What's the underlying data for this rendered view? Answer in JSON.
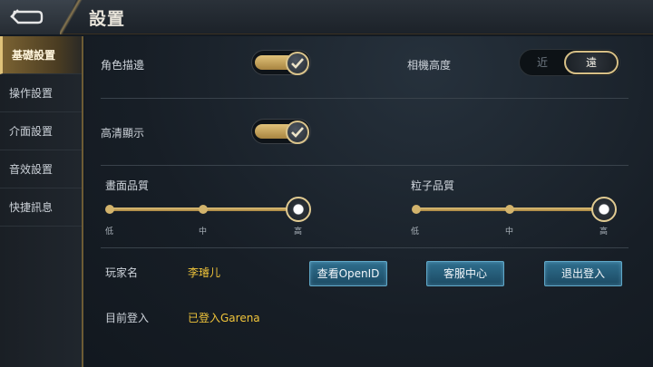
{
  "header": {
    "title": "設置"
  },
  "sidebar": {
    "items": [
      {
        "label": "基礎設置",
        "active": true
      },
      {
        "label": "操作設置"
      },
      {
        "label": "介面設置"
      },
      {
        "label": "音效設置"
      },
      {
        "label": "快捷訊息"
      }
    ]
  },
  "settings": {
    "outline": {
      "label": "角色描邊",
      "checked": true
    },
    "camera": {
      "label": "相機高度",
      "options": [
        "近",
        "遠"
      ],
      "selected": "遠"
    },
    "hd": {
      "label": "高清顯示",
      "checked": true
    },
    "graphics": {
      "label": "畫面品質",
      "ticks": [
        "低",
        "中",
        "高"
      ],
      "value": "高"
    },
    "particles": {
      "label": "粒子品質",
      "ticks": [
        "低",
        "中",
        "高"
      ],
      "value": "高"
    }
  },
  "account": {
    "player_label": "玩家名",
    "player_name": "李璿儿",
    "login_label": "目前登入",
    "login_value": "已登入Garena",
    "buttons": {
      "openid": "查看OpenID",
      "support": "客服中心",
      "logout": "退出登入"
    }
  },
  "colors": {
    "accent_gold": "#d9c38b",
    "value_yellow": "#f0c43a",
    "button_blue": "#2f6f8e"
  }
}
